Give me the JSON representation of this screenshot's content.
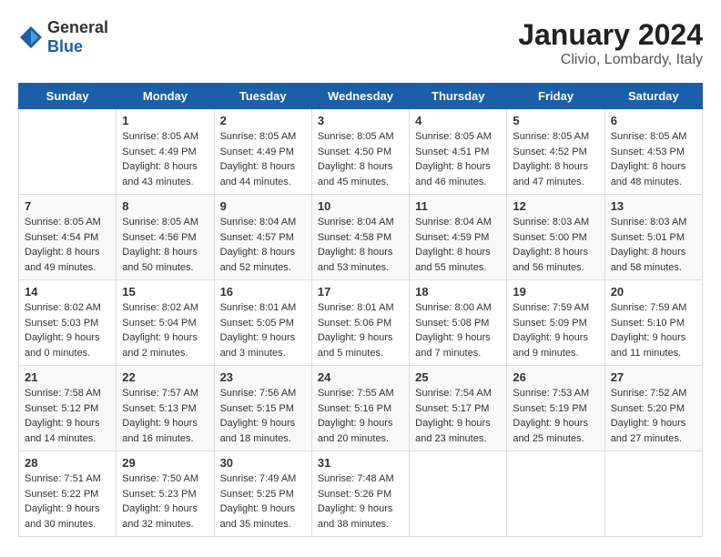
{
  "header": {
    "logo": {
      "general": "General",
      "blue": "Blue"
    },
    "month": "January 2024",
    "location": "Clivio, Lombardy, Italy"
  },
  "calendar": {
    "days_of_week": [
      "Sunday",
      "Monday",
      "Tuesday",
      "Wednesday",
      "Thursday",
      "Friday",
      "Saturday"
    ],
    "weeks": [
      [
        {
          "day": "",
          "info": ""
        },
        {
          "day": "1",
          "info": "Sunrise: 8:05 AM\nSunset: 4:49 PM\nDaylight: 8 hours\nand 43 minutes."
        },
        {
          "day": "2",
          "info": "Sunrise: 8:05 AM\nSunset: 4:49 PM\nDaylight: 8 hours\nand 44 minutes."
        },
        {
          "day": "3",
          "info": "Sunrise: 8:05 AM\nSunset: 4:50 PM\nDaylight: 8 hours\nand 45 minutes."
        },
        {
          "day": "4",
          "info": "Sunrise: 8:05 AM\nSunset: 4:51 PM\nDaylight: 8 hours\nand 46 minutes."
        },
        {
          "day": "5",
          "info": "Sunrise: 8:05 AM\nSunset: 4:52 PM\nDaylight: 8 hours\nand 47 minutes."
        },
        {
          "day": "6",
          "info": "Sunrise: 8:05 AM\nSunset: 4:53 PM\nDaylight: 8 hours\nand 48 minutes."
        }
      ],
      [
        {
          "day": "7",
          "info": "Sunrise: 8:05 AM\nSunset: 4:54 PM\nDaylight: 8 hours\nand 49 minutes."
        },
        {
          "day": "8",
          "info": "Sunrise: 8:05 AM\nSunset: 4:56 PM\nDaylight: 8 hours\nand 50 minutes."
        },
        {
          "day": "9",
          "info": "Sunrise: 8:04 AM\nSunset: 4:57 PM\nDaylight: 8 hours\nand 52 minutes."
        },
        {
          "day": "10",
          "info": "Sunrise: 8:04 AM\nSunset: 4:58 PM\nDaylight: 8 hours\nand 53 minutes."
        },
        {
          "day": "11",
          "info": "Sunrise: 8:04 AM\nSunset: 4:59 PM\nDaylight: 8 hours\nand 55 minutes."
        },
        {
          "day": "12",
          "info": "Sunrise: 8:03 AM\nSunset: 5:00 PM\nDaylight: 8 hours\nand 56 minutes."
        },
        {
          "day": "13",
          "info": "Sunrise: 8:03 AM\nSunset: 5:01 PM\nDaylight: 8 hours\nand 58 minutes."
        }
      ],
      [
        {
          "day": "14",
          "info": "Sunrise: 8:02 AM\nSunset: 5:03 PM\nDaylight: 9 hours\nand 0 minutes."
        },
        {
          "day": "15",
          "info": "Sunrise: 8:02 AM\nSunset: 5:04 PM\nDaylight: 9 hours\nand 2 minutes."
        },
        {
          "day": "16",
          "info": "Sunrise: 8:01 AM\nSunset: 5:05 PM\nDaylight: 9 hours\nand 3 minutes."
        },
        {
          "day": "17",
          "info": "Sunrise: 8:01 AM\nSunset: 5:06 PM\nDaylight: 9 hours\nand 5 minutes."
        },
        {
          "day": "18",
          "info": "Sunrise: 8:00 AM\nSunset: 5:08 PM\nDaylight: 9 hours\nand 7 minutes."
        },
        {
          "day": "19",
          "info": "Sunrise: 7:59 AM\nSunset: 5:09 PM\nDaylight: 9 hours\nand 9 minutes."
        },
        {
          "day": "20",
          "info": "Sunrise: 7:59 AM\nSunset: 5:10 PM\nDaylight: 9 hours\nand 11 minutes."
        }
      ],
      [
        {
          "day": "21",
          "info": "Sunrise: 7:58 AM\nSunset: 5:12 PM\nDaylight: 9 hours\nand 14 minutes."
        },
        {
          "day": "22",
          "info": "Sunrise: 7:57 AM\nSunset: 5:13 PM\nDaylight: 9 hours\nand 16 minutes."
        },
        {
          "day": "23",
          "info": "Sunrise: 7:56 AM\nSunset: 5:15 PM\nDaylight: 9 hours\nand 18 minutes."
        },
        {
          "day": "24",
          "info": "Sunrise: 7:55 AM\nSunset: 5:16 PM\nDaylight: 9 hours\nand 20 minutes."
        },
        {
          "day": "25",
          "info": "Sunrise: 7:54 AM\nSunset: 5:17 PM\nDaylight: 9 hours\nand 23 minutes."
        },
        {
          "day": "26",
          "info": "Sunrise: 7:53 AM\nSunset: 5:19 PM\nDaylight: 9 hours\nand 25 minutes."
        },
        {
          "day": "27",
          "info": "Sunrise: 7:52 AM\nSunset: 5:20 PM\nDaylight: 9 hours\nand 27 minutes."
        }
      ],
      [
        {
          "day": "28",
          "info": "Sunrise: 7:51 AM\nSunset: 5:22 PM\nDaylight: 9 hours\nand 30 minutes."
        },
        {
          "day": "29",
          "info": "Sunrise: 7:50 AM\nSunset: 5:23 PM\nDaylight: 9 hours\nand 32 minutes."
        },
        {
          "day": "30",
          "info": "Sunrise: 7:49 AM\nSunset: 5:25 PM\nDaylight: 9 hours\nand 35 minutes."
        },
        {
          "day": "31",
          "info": "Sunrise: 7:48 AM\nSunset: 5:26 PM\nDaylight: 9 hours\nand 38 minutes."
        },
        {
          "day": "",
          "info": ""
        },
        {
          "day": "",
          "info": ""
        },
        {
          "day": "",
          "info": ""
        }
      ]
    ]
  }
}
